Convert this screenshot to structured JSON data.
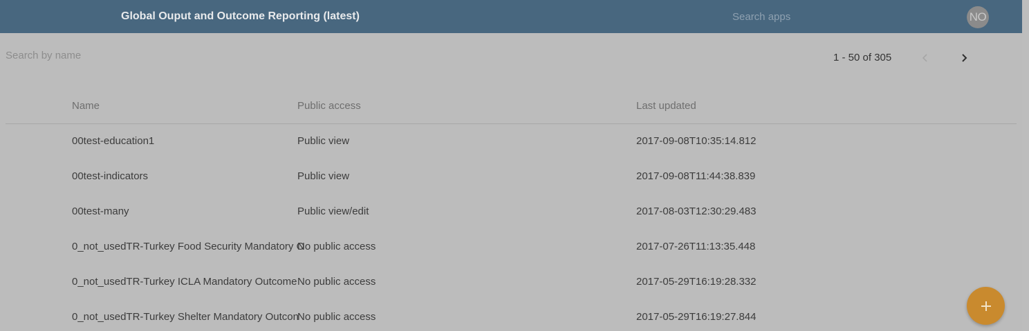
{
  "header": {
    "app_title": "Global Ouput and Outcome Reporting (latest)",
    "search_apps_placeholder": "Search apps",
    "avatar_initials": "NO"
  },
  "toolbar": {
    "search_name_placeholder": "Search by name",
    "pagination_label": "1 - 50 of 305",
    "prev_icon": "chevron-left-icon",
    "next_icon": "chevron-right-icon"
  },
  "table": {
    "columns": {
      "name": "Name",
      "public_access": "Public access",
      "last_updated": "Last updated"
    },
    "rows": [
      {
        "name": "00test-education1",
        "access": "Public view",
        "updated": "2017-09-08T10:35:14.812"
      },
      {
        "name": "00test-indicators",
        "access": "Public view",
        "updated": "2017-09-08T11:44:38.839"
      },
      {
        "name": "00test-many",
        "access": "Public view/edit",
        "updated": "2017-08-03T12:30:29.483"
      },
      {
        "name": "0_not_usedTR-Turkey Food Security Mandatory O",
        "access": "No public access",
        "updated": "2017-07-26T11:13:35.448"
      },
      {
        "name": "0_not_usedTR-Turkey ICLA Mandatory Outcome",
        "access": "No public access",
        "updated": "2017-05-29T16:19:28.332"
      },
      {
        "name": "0_not_usedTR-Turkey Shelter Mandatory Outcon",
        "access": "No public access",
        "updated": "2017-05-29T16:19:27.844"
      }
    ]
  },
  "fab": {
    "icon": "plus-icon"
  },
  "colors": {
    "header_bg": "#48677f",
    "page_bg": "#bcbcbc",
    "fab_bg": "#c98a2e"
  }
}
